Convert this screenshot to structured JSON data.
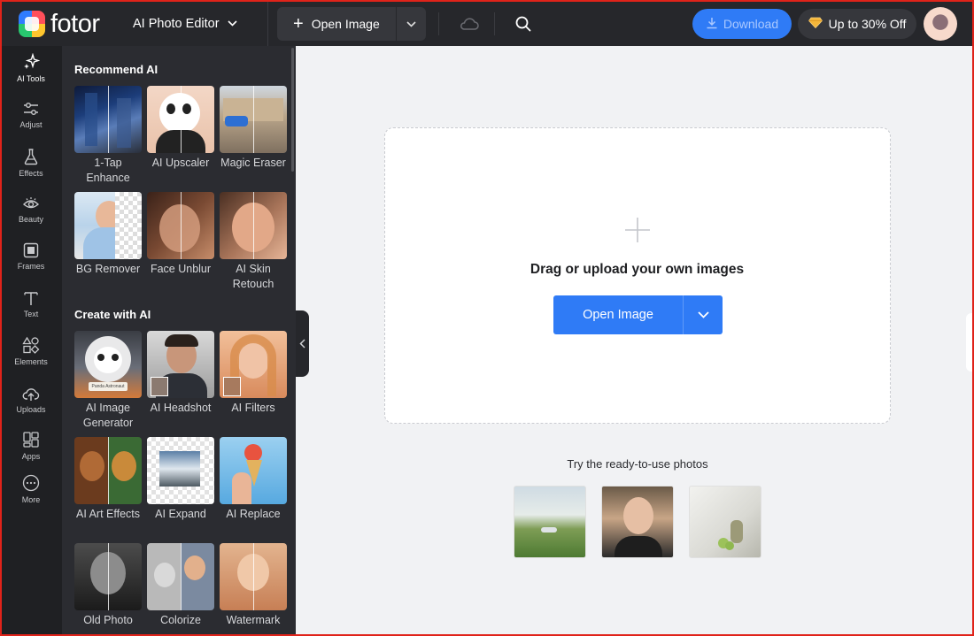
{
  "brand": {
    "name": "fotor"
  },
  "header": {
    "editor_title": "AI Photo Editor",
    "open_image_label": "Open Image",
    "download_label": "Download",
    "promo_label": "Up to 30% Off"
  },
  "rail": {
    "items": [
      {
        "label": "AI Tools",
        "icon": "sparkle-icon"
      },
      {
        "label": "Adjust",
        "icon": "sliders-icon"
      },
      {
        "label": "Effects",
        "icon": "flask-icon"
      },
      {
        "label": "Beauty",
        "icon": "eye-icon"
      },
      {
        "label": "Frames",
        "icon": "frame-icon"
      },
      {
        "label": "Text",
        "icon": "text-icon"
      },
      {
        "label": "Elements",
        "icon": "shapes-icon"
      },
      {
        "label": "Uploads",
        "icon": "upload-cloud-icon"
      },
      {
        "label": "Apps",
        "icon": "apps-icon"
      },
      {
        "label": "More",
        "icon": "more-icon"
      }
    ]
  },
  "panel": {
    "recommend_title": "Recommend AI",
    "create_title": "Create with AI",
    "recommend": [
      {
        "label": "1-Tap Enhance"
      },
      {
        "label": "AI Upscaler"
      },
      {
        "label": "Magic Eraser"
      },
      {
        "label": "BG Remover"
      },
      {
        "label": "Face Unblur"
      },
      {
        "label": "AI Skin Retouch"
      }
    ],
    "create": [
      {
        "label": "AI Image Generator"
      },
      {
        "label": "AI Headshot"
      },
      {
        "label": "AI Filters"
      },
      {
        "label": "AI Art Effects"
      },
      {
        "label": "AI Expand"
      },
      {
        "label": "AI Replace"
      },
      {
        "label": "Old Photo"
      },
      {
        "label": "Colorize"
      },
      {
        "label": "Watermark"
      }
    ],
    "tile_caption": "Panda Astronaut"
  },
  "canvas": {
    "drop_text": "Drag or upload your own images",
    "open_image_label": "Open Image",
    "try_text": "Try the ready-to-use photos"
  },
  "colors": {
    "accent": "#2f7bf6",
    "topbar": "#26272b",
    "rail": "#1f2023",
    "panel": "#2b2c31",
    "canvas": "#f1f2f4"
  }
}
